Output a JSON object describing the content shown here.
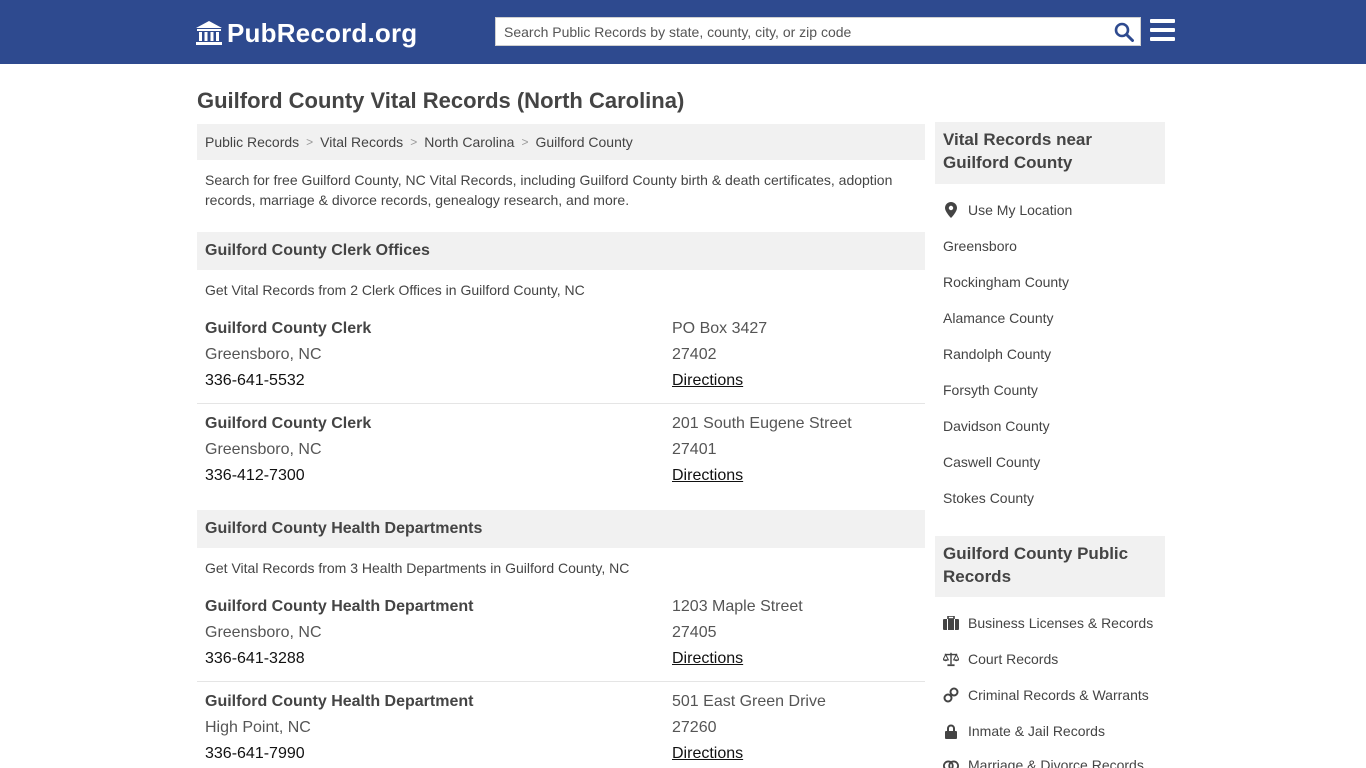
{
  "header": {
    "logo_text": "PubRecord.org",
    "search_placeholder": "Search Public Records by state, county, city, or zip code"
  },
  "page_title": "Guilford County Vital Records (North Carolina)",
  "breadcrumb": [
    "Public Records",
    "Vital Records",
    "North Carolina",
    "Guilford County"
  ],
  "intro": "Search for free Guilford County, NC Vital Records, including Guilford County birth & death certificates, adoption records, marriage & divorce records, genealogy research, and more.",
  "clerk": {
    "heading": "Guilford County Clerk Offices",
    "sub": "Get Vital Records from 2 Clerk Offices in Guilford County, NC",
    "entries": [
      {
        "name": "Guilford County Clerk",
        "city": "Greensboro, NC",
        "phone": "336-641-5532",
        "address": "PO Box 3427",
        "zip": "27402",
        "directions": "Directions"
      },
      {
        "name": "Guilford County Clerk",
        "city": "Greensboro, NC",
        "phone": "336-412-7300",
        "address": "201 South Eugene Street",
        "zip": "27401",
        "directions": "Directions"
      }
    ]
  },
  "health": {
    "heading": "Guilford County Health Departments",
    "sub": "Get Vital Records from 3 Health Departments in Guilford County, NC",
    "entries": [
      {
        "name": "Guilford County Health Department",
        "city": "Greensboro, NC",
        "phone": "336-641-3288",
        "address": "1203 Maple Street",
        "zip": "27405",
        "directions": "Directions"
      },
      {
        "name": "Guilford County Health Department",
        "city": "High Point, NC",
        "phone": "336-641-7990",
        "address": "501 East Green Drive",
        "zip": "27260",
        "directions": "Directions"
      }
    ]
  },
  "sidebar": {
    "nearby_heading": "Vital Records near Guilford County",
    "use_location": "Use My Location",
    "nearby": [
      "Greensboro",
      "Rockingham County",
      "Alamance County",
      "Randolph County",
      "Forsyth County",
      "Davidson County",
      "Caswell County",
      "Stokes County"
    ],
    "public_heading": "Guilford County Public Records",
    "public_links": [
      "Business Licenses & Records",
      "Court Records",
      "Criminal Records & Warrants",
      "Inmate & Jail Records",
      "Marriage & Divorce Records"
    ]
  },
  "colors": {
    "header_bg": "#2e4a8f",
    "panel_bg": "#f1f1f1",
    "text": "#444444"
  }
}
